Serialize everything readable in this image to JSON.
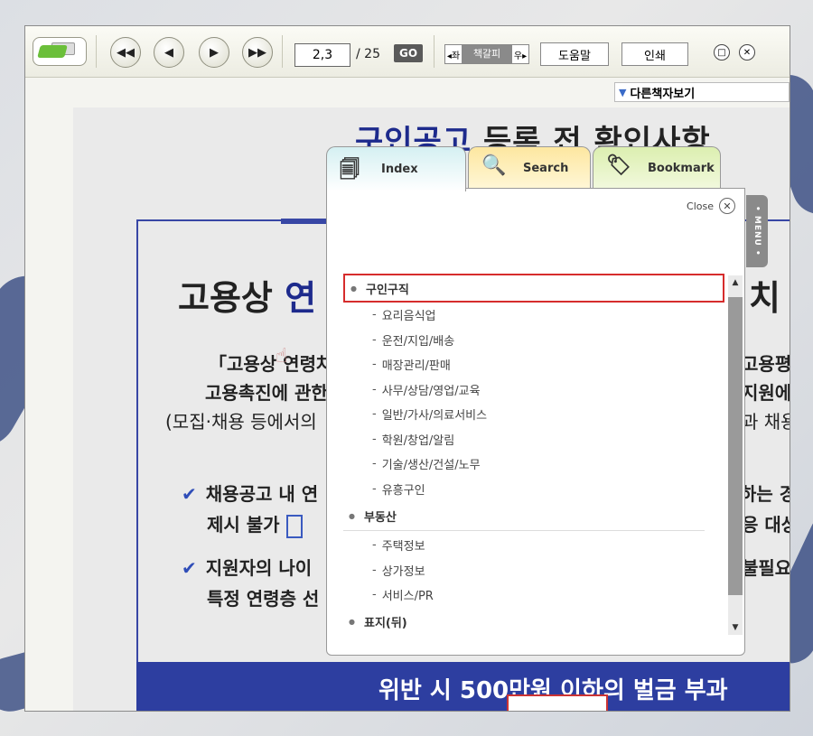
{
  "toolbar": {
    "first_page_icon": "double-left-arrow-icon",
    "prev_page_icon": "left-arrow-icon",
    "next_page_icon": "right-arrow-icon",
    "last_page_icon": "double-right-arrow-icon",
    "page_value": "2,3",
    "page_total": "/ 25",
    "go_label": "GO",
    "flip_left": "◂좌",
    "flip_label": "책갈피",
    "flip_right": "우▸",
    "help_label": "도움말",
    "print_label": "인쇄",
    "restore_glyph": "□",
    "close_glyph": "✕"
  },
  "other_books": {
    "label": "다른책자보기"
  },
  "document": {
    "title_highlight": "구인공고",
    "title_rest": " 등록 전 확인사항",
    "heading_prefix": "고용상 ",
    "heading_highlight": "연",
    "heading_right": "치",
    "line1_left": "「고용상",
    "line1_mid": "연령차",
    "line1_right": "고용평",
    "line2_left": "고용촉진에 관한",
    "line2_right": "지원에",
    "line3_left": "(모집·채용 등에서의",
    "line3_right": "과 채용",
    "bullet1_a": "채용공고 내 연",
    "bullet1_right": "하는 경",
    "bullet1_b": "제시 불가",
    "bullet1_b_right": "응 대상",
    "bullet2_a": "지원자의 나이",
    "bullet2_right": "불필요",
    "bullet2_b": "특정 연령층 선",
    "band_text": "위반 시 500만원 이하의 벌금 부과"
  },
  "panel": {
    "tabs": [
      {
        "label": "Index",
        "icon": "stack-icon"
      },
      {
        "label": "Search",
        "icon": "magnifier-icon"
      },
      {
        "label": "Bookmark",
        "icon": "tag-icon"
      }
    ],
    "close_label": "Close",
    "menu_label": "• MENU •",
    "tree": [
      {
        "label": "구인구직",
        "selected": true,
        "children": [
          "요리음식업",
          "운전/지입/배송",
          "매장관리/판매",
          "사무/상담/영업/교육",
          "일반/가사/의료서비스",
          "학원/창업/알림",
          "기술/생산/건설/노무",
          "유흥구인"
        ]
      },
      {
        "label": "부동산",
        "selected": false,
        "children": [
          "주택정보",
          "상가정보",
          "서비스/PR"
        ]
      },
      {
        "label": "표지(뒤)",
        "selected": false,
        "children": []
      }
    ]
  }
}
